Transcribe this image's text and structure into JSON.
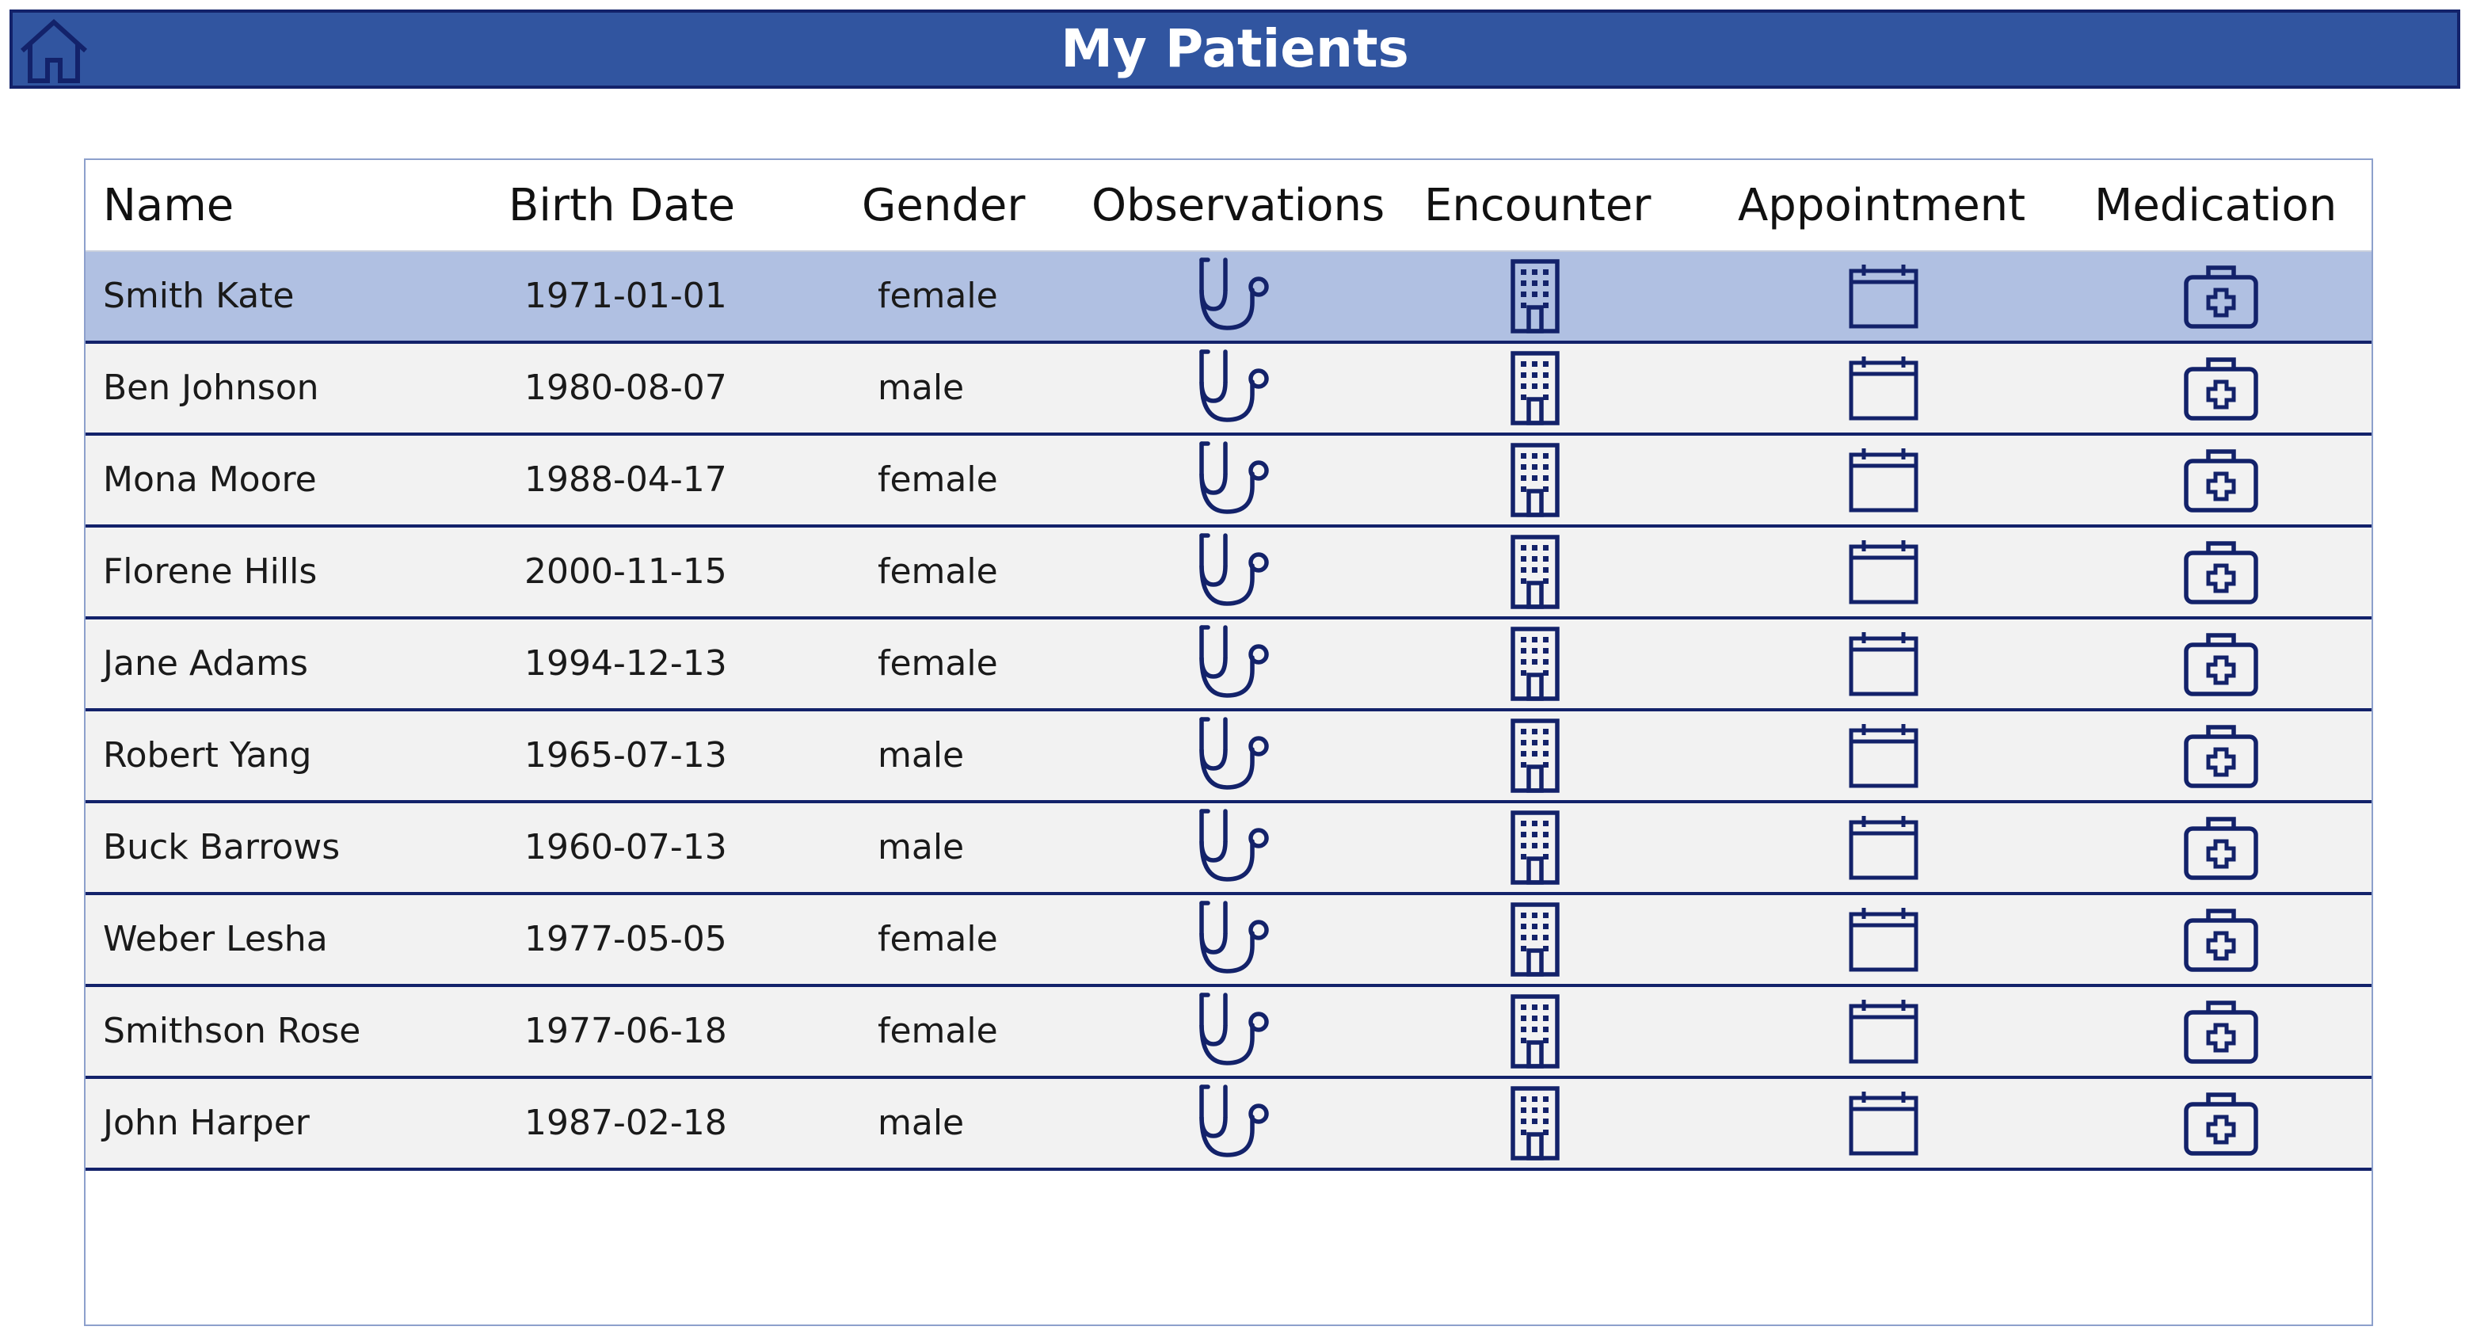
{
  "header": {
    "title": "My Patients",
    "home_icon": "home-icon"
  },
  "table": {
    "columns": {
      "name": "Name",
      "birth_date": "Birth Date",
      "gender": "Gender",
      "observations": "Observations",
      "encounter": "Encounter",
      "appointment": "Appointment",
      "medication": "Medication"
    },
    "icons": {
      "observations": "stethoscope-icon",
      "encounter": "building-icon",
      "appointment": "calendar-icon",
      "medication": "medical-kit-icon"
    },
    "selected_row_index": 0,
    "rows": [
      {
        "name": "Smith Kate",
        "birth_date": "1971-01-01",
        "gender": "female"
      },
      {
        "name": "Ben Johnson",
        "birth_date": "1980-08-07",
        "gender": "male"
      },
      {
        "name": "Mona Moore",
        "birth_date": "1988-04-17",
        "gender": "female"
      },
      {
        "name": "Florene Hills",
        "birth_date": "2000-11-15",
        "gender": "female"
      },
      {
        "name": "Jane Adams",
        "birth_date": "1994-12-13",
        "gender": "female"
      },
      {
        "name": "Robert Yang",
        "birth_date": "1965-07-13",
        "gender": "male"
      },
      {
        "name": "Buck Barrows",
        "birth_date": "1960-07-13",
        "gender": "male"
      },
      {
        "name": "Weber Lesha",
        "birth_date": "1977-05-05",
        "gender": "female"
      },
      {
        "name": "Smithson Rose",
        "birth_date": "1977-06-18",
        "gender": "female"
      },
      {
        "name": "John Harper",
        "birth_date": "1987-02-18",
        "gender": "male"
      }
    ]
  },
  "colors": {
    "header_background": "#3155a0",
    "header_border": "#13226a",
    "icon_color": "#13226a",
    "row_background": "#f2f2f2",
    "selected_row_background": "#b0c0e2",
    "row_divider": "#13226a"
  }
}
